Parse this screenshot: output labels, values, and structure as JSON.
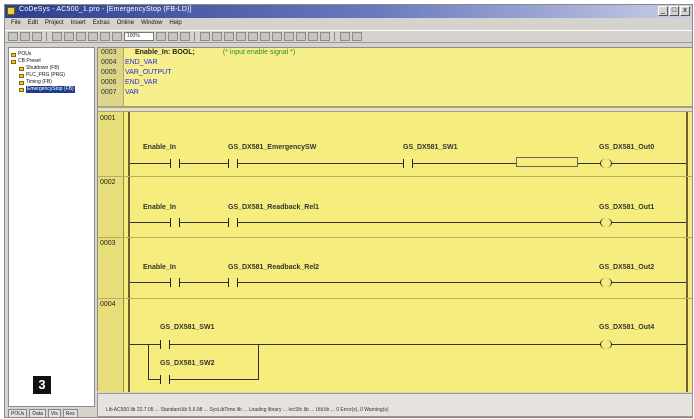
{
  "window": {
    "title": "CoDeSys - AC500_1.pro - [EmergencyStop (FB-LD)]",
    "controls": [
      "_",
      "□",
      "x"
    ]
  },
  "menu": [
    "File",
    "Edit",
    "Project",
    "Insert",
    "Extras",
    "Online",
    "Window",
    "Help"
  ],
  "toolbar": {
    "zoom_value": "100%"
  },
  "sidebar": {
    "tree": [
      {
        "label": "POUs",
        "level": 0
      },
      {
        "label": "CB Preset",
        "level": 0
      },
      {
        "label": "Shutdown (FB)",
        "level": 1
      },
      {
        "label": "PLC_PRG (PRG)",
        "level": 1
      },
      {
        "label": "Timing (FB)",
        "level": 1
      },
      {
        "label": "EmergencyStop (FB)",
        "level": 1,
        "selected": true
      }
    ],
    "tabs": [
      "POUs",
      "Data",
      "Vis",
      "Res"
    ]
  },
  "badge": "3",
  "declarations": [
    {
      "num": "0003",
      "text": "Enable_In: BOOL;",
      "comment": "(* input enable signal *)"
    },
    {
      "num": "0004",
      "text": "END_VAR"
    },
    {
      "num": "0005",
      "text": "VAR_OUTPUT"
    },
    {
      "num": "0006",
      "text": "END_VAR"
    },
    {
      "num": "0007",
      "text": "VAR"
    }
  ],
  "networks": [
    {
      "num": "0001",
      "contacts": [
        "Enable_In",
        "GS_DX581_EmergencySW",
        "GS_DX581_SW1"
      ],
      "coil": "GS_DX581_Out0"
    },
    {
      "num": "0002",
      "contacts": [
        "Enable_In",
        "GS_DX581_Readback_Rel1"
      ],
      "coil": "GS_DX581_Out1"
    },
    {
      "num": "0003",
      "contacts": [
        "Enable_In",
        "GS_DX581_Readback_Rel2"
      ],
      "coil": "GS_DX581_Out2"
    },
    {
      "num": "0004",
      "contacts": [
        "GS_DX581_SW1"
      ],
      "parallel": "GS_DX581_SW2",
      "coil": "GS_DX581_Out4"
    }
  ],
  "statusbar": {
    "text": "Lib AC500.lib 22.7.05 ... Standard.lib 5.6.98 ... SysLibTime.lib ... Loading library ... IecSfc.lib ... Util.lib ... 0 Error(s), 0 Warning(s)"
  }
}
